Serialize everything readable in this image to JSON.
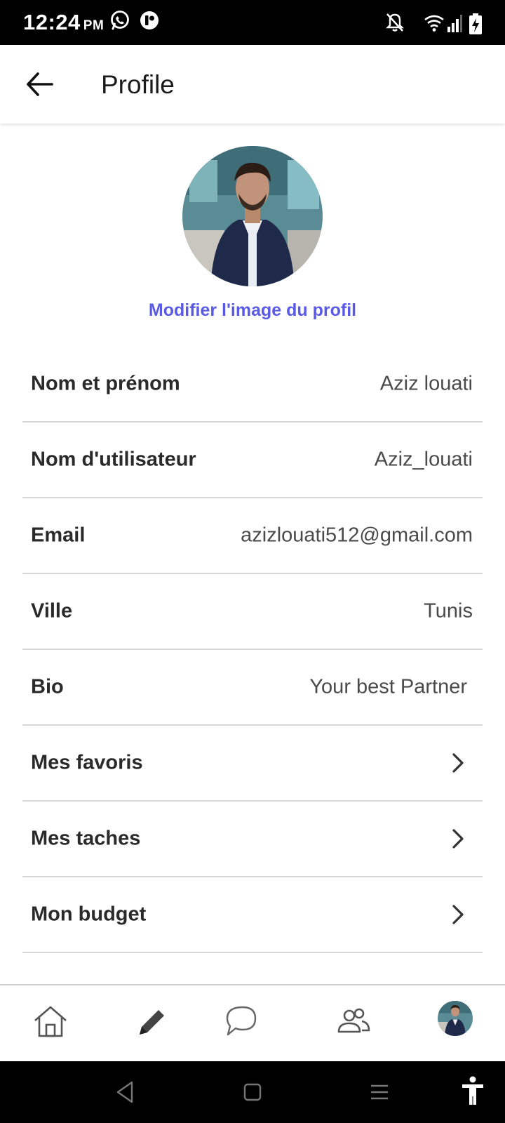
{
  "status_bar": {
    "time": "12:24",
    "ampm": "PM",
    "icons": [
      "whatsapp-icon",
      "app-notification-icon",
      "notifications-off-icon",
      "wifi-icon",
      "signal-icon",
      "battery-charging-icon"
    ]
  },
  "header": {
    "back_icon": "arrow-left-icon",
    "title": "Profile"
  },
  "profile": {
    "change_photo_label": "Modifier l'image du profil"
  },
  "fields": [
    {
      "label": "Nom et prénom",
      "value": "Aziz louati"
    },
    {
      "label": "Nom d'utilisateur",
      "value": "Aziz_louati"
    },
    {
      "label": "Email",
      "value": "azizlouati512@gmail.com"
    },
    {
      "label": "Ville",
      "value": "Tunis"
    },
    {
      "label": "Bio",
      "value": "Your best Partner"
    }
  ],
  "links": [
    {
      "label": "Mes favoris",
      "icon": "chevron-right-icon"
    },
    {
      "label": "Mes taches",
      "icon": "chevron-right-icon"
    },
    {
      "label": "Mon budget",
      "icon": "chevron-right-icon"
    }
  ],
  "bottom_nav": [
    "home-icon",
    "pencil-icon",
    "chat-icon",
    "people-icon",
    "profile-avatar"
  ],
  "system_nav": [
    "back-triangle-icon",
    "home-square-icon",
    "recents-menu-icon",
    "accessibility-icon"
  ],
  "colors": {
    "accent": "#5a5ae6",
    "status_bar": "#000000",
    "divider": "#d7d7d7"
  }
}
